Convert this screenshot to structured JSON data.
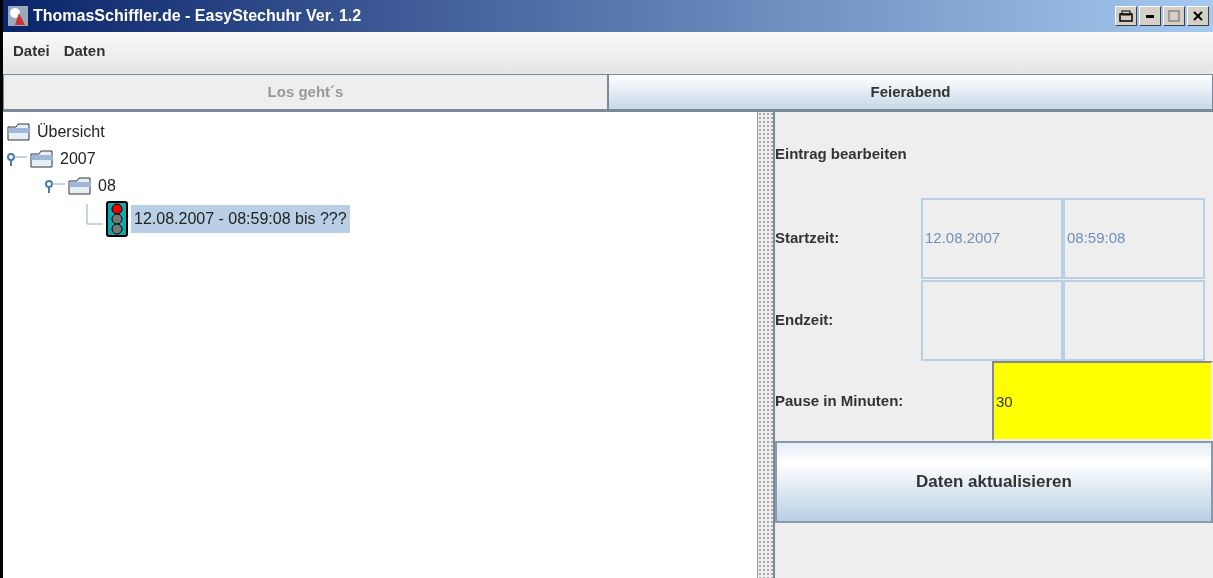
{
  "window": {
    "title": "ThomasSchiffler.de - EasyStechuhr Ver. 1.2"
  },
  "menu": [
    "Datei",
    "Daten"
  ],
  "toolbar": [
    {
      "label": "Los geht´s",
      "disabled": true
    },
    {
      "label": "Feierabend",
      "disabled": false
    }
  ],
  "tree": [
    {
      "label": "Übersicht",
      "kind": "folder",
      "selected": false,
      "children": [
        {
          "label": "2007",
          "kind": "folder",
          "selected": false,
          "expanded": true,
          "children": [
            {
              "label": "08",
              "kind": "folder",
              "selected": false,
              "expanded": true,
              "children": [
                {
                  "label": "12.08.2007 - 08:59:08 bis  ???",
                  "kind": "entry",
                  "selected": true
                }
              ]
            }
          ]
        }
      ]
    }
  ],
  "editor": {
    "heading": "Eintrag bearbeiten",
    "start": {
      "label": "Startzeit:",
      "date": "12.08.2007",
      "time": "08:59:08",
      "disabled": true
    },
    "end": {
      "label": "Endzeit:",
      "disabled": true
    },
    "pause": {
      "label": "Pause in Minuten:",
      "value": "30"
    },
    "button": "Daten aktualisieren"
  }
}
